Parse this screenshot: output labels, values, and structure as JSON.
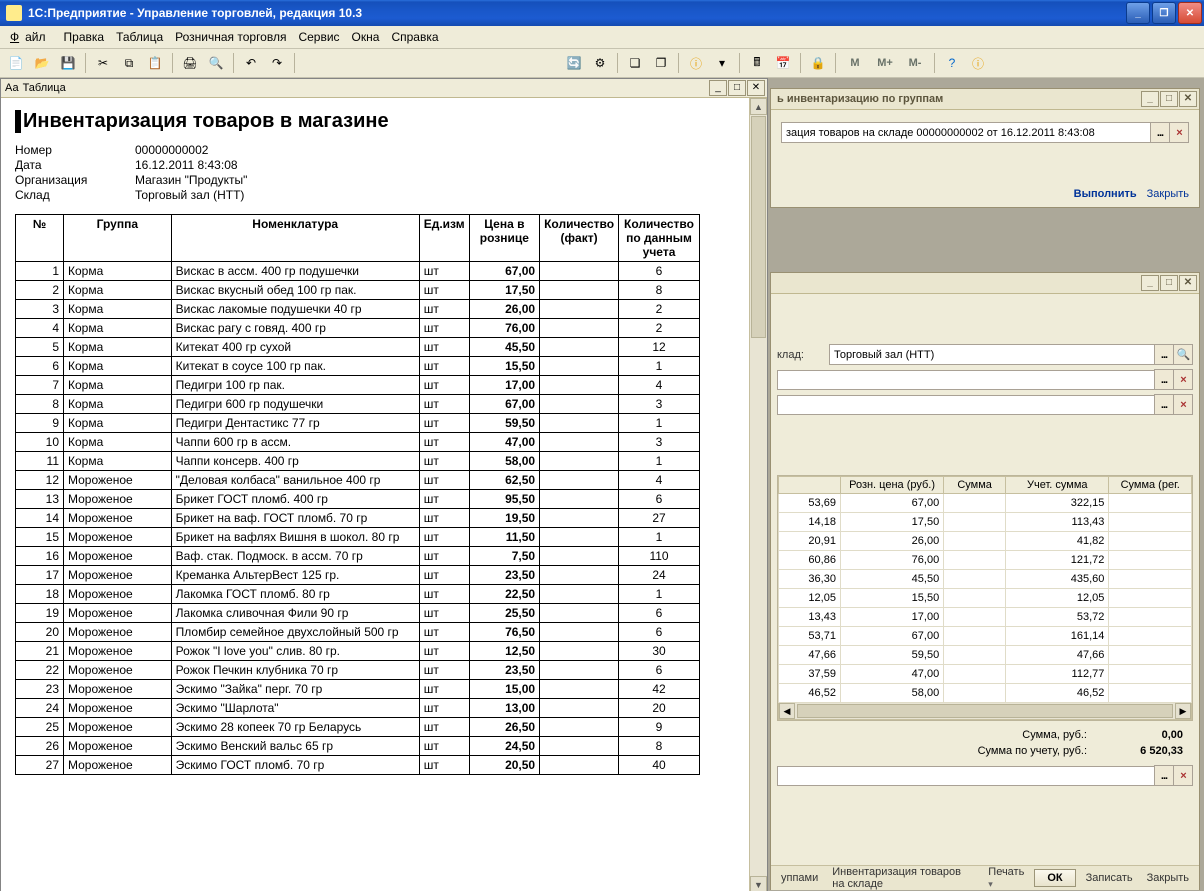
{
  "app": {
    "title": "1С:Предприятие - Управление торговлей, редакция 10.3"
  },
  "menu": {
    "items": [
      "Файл",
      "Правка",
      "Таблица",
      "Розничная торговля",
      "Сервис",
      "Окна",
      "Справка"
    ]
  },
  "toolbar": {
    "m_label": "М",
    "mplus_label": "М+",
    "mminus_label": "М-"
  },
  "doc": {
    "tab_label": "Таблица",
    "title": "Инвентаризация товаров в магазине",
    "info": {
      "number_label": "Номер",
      "number": "00000000002",
      "date_label": "Дата",
      "date": "16.12.2011 8:43:08",
      "org_label": "Организация",
      "org": "Магазин \"Продукты\"",
      "store_label": "Склад",
      "store": "Торговый зал (НТТ)"
    },
    "columns": [
      "№",
      "Группа",
      "Номенклатура",
      "Ед.изм",
      "Цена в рознице",
      "Количество (факт)",
      "Количество по данным учета"
    ],
    "rows": [
      {
        "n": 1,
        "g": "Корма",
        "nom": "Вискас в ассм. 400 гр подушечки",
        "u": "шт",
        "price": "67,00",
        "fact": "",
        "acc": "6"
      },
      {
        "n": 2,
        "g": "Корма",
        "nom": "Вискас вкусный обед 100 гр пак.",
        "u": "шт",
        "price": "17,50",
        "fact": "",
        "acc": "8"
      },
      {
        "n": 3,
        "g": "Корма",
        "nom": "Вискас лакомые подушечки 40 гр",
        "u": "шт",
        "price": "26,00",
        "fact": "",
        "acc": "2"
      },
      {
        "n": 4,
        "g": "Корма",
        "nom": "Вискас рагу с говяд. 400 гр",
        "u": "шт",
        "price": "76,00",
        "fact": "",
        "acc": "2"
      },
      {
        "n": 5,
        "g": "Корма",
        "nom": "Китекат 400 гр сухой",
        "u": "шт",
        "price": "45,50",
        "fact": "",
        "acc": "12"
      },
      {
        "n": 6,
        "g": "Корма",
        "nom": "Китекат в соусе 100 гр пак.",
        "u": "шт",
        "price": "15,50",
        "fact": "",
        "acc": "1"
      },
      {
        "n": 7,
        "g": "Корма",
        "nom": "Педигри 100 гр пак.",
        "u": "шт",
        "price": "17,00",
        "fact": "",
        "acc": "4"
      },
      {
        "n": 8,
        "g": "Корма",
        "nom": "Педигри 600 гр подушечки",
        "u": "шт",
        "price": "67,00",
        "fact": "",
        "acc": "3"
      },
      {
        "n": 9,
        "g": "Корма",
        "nom": "Педигри Дентастикс 77 гр",
        "u": "шт",
        "price": "59,50",
        "fact": "",
        "acc": "1"
      },
      {
        "n": 10,
        "g": "Корма",
        "nom": "Чаппи 600 гр в ассм.",
        "u": "шт",
        "price": "47,00",
        "fact": "",
        "acc": "3"
      },
      {
        "n": 11,
        "g": "Корма",
        "nom": "Чаппи консерв. 400 гр",
        "u": "шт",
        "price": "58,00",
        "fact": "",
        "acc": "1"
      },
      {
        "n": 12,
        "g": "Мороженое",
        "nom": "\"Деловая колбаса\" ванильное 400 гр",
        "u": "шт",
        "price": "62,50",
        "fact": "",
        "acc": "4"
      },
      {
        "n": 13,
        "g": "Мороженое",
        "nom": "Брикет ГОСТ пломб. 400 гр",
        "u": "шт",
        "price": "95,50",
        "fact": "",
        "acc": "6"
      },
      {
        "n": 14,
        "g": "Мороженое",
        "nom": "Брикет на ваф. ГОСТ пломб. 70 гр",
        "u": "шт",
        "price": "19,50",
        "fact": "",
        "acc": "27"
      },
      {
        "n": 15,
        "g": "Мороженое",
        "nom": "Брикет на вафлях Вишня в шокол. 80 гр",
        "u": "шт",
        "price": "11,50",
        "fact": "",
        "acc": "1"
      },
      {
        "n": 16,
        "g": "Мороженое",
        "nom": "Ваф. стак. Подмоск. в ассм. 70 гр",
        "u": "шт",
        "price": "7,50",
        "fact": "",
        "acc": "110"
      },
      {
        "n": 17,
        "g": "Мороженое",
        "nom": "Креманка АльтерВест 125 гр.",
        "u": "шт",
        "price": "23,50",
        "fact": "",
        "acc": "24"
      },
      {
        "n": 18,
        "g": "Мороженое",
        "nom": "Лакомка ГОСТ пломб. 80 гр",
        "u": "шт",
        "price": "22,50",
        "fact": "",
        "acc": "1"
      },
      {
        "n": 19,
        "g": "Мороженое",
        "nom": "Лакомка сливочная Фили 90 гр",
        "u": "шт",
        "price": "25,50",
        "fact": "",
        "acc": "6"
      },
      {
        "n": 20,
        "g": "Мороженое",
        "nom": "Пломбир семейное двухслойный 500 гр",
        "u": "шт",
        "price": "76,50",
        "fact": "",
        "acc": "6"
      },
      {
        "n": 21,
        "g": "Мороженое",
        "nom": "Рожок \"I love you\" слив. 80 гр.",
        "u": "шт",
        "price": "12,50",
        "fact": "",
        "acc": "30"
      },
      {
        "n": 22,
        "g": "Мороженое",
        "nom": "Рожок Печкин клубника 70 гр",
        "u": "шт",
        "price": "23,50",
        "fact": "",
        "acc": "6"
      },
      {
        "n": 23,
        "g": "Мороженое",
        "nom": "Эскимо \"Зайка\" перг. 70 гр",
        "u": "шт",
        "price": "15,00",
        "fact": "",
        "acc": "42"
      },
      {
        "n": 24,
        "g": "Мороженое",
        "nom": "Эскимо \"Шарлота\"",
        "u": "шт",
        "price": "13,00",
        "fact": "",
        "acc": "20"
      },
      {
        "n": 25,
        "g": "Мороженое",
        "nom": "Эскимо 28 копеек 70 гр Беларусь",
        "u": "шт",
        "price": "26,50",
        "fact": "",
        "acc": "9"
      },
      {
        "n": 26,
        "g": "Мороженое",
        "nom": "Эскимо Венский вальс 65 гр",
        "u": "шт",
        "price": "24,50",
        "fact": "",
        "acc": "8"
      },
      {
        "n": 27,
        "g": "Мороженое",
        "nom": "Эскимо ГОСТ пломб. 70 гр",
        "u": "шт",
        "price": "20,50",
        "fact": "",
        "acc": "40"
      }
    ]
  },
  "dlg1": {
    "title_suffix": "ь инвентаризацию по группам",
    "value_prefix": "зация товаров на складе 00000000002 от 16.12.2011 8:43:08",
    "execute": "Выполнить",
    "close": "Закрыть"
  },
  "dlg2": {
    "store_label": "клад:",
    "store_value": "Торговый зал (НТТ)",
    "grid_columns": [
      "",
      "Розн. цена (руб.)",
      "Сумма",
      "Учет. сумма",
      "Сумма (рег."
    ],
    "grid_rows": [
      {
        "c1": "53,69",
        "c2": "67,00",
        "c3": "",
        "c4": "322,15",
        "c5": ""
      },
      {
        "c1": "14,18",
        "c2": "17,50",
        "c3": "",
        "c4": "113,43",
        "c5": ""
      },
      {
        "c1": "20,91",
        "c2": "26,00",
        "c3": "",
        "c4": "41,82",
        "c5": ""
      },
      {
        "c1": "60,86",
        "c2": "76,00",
        "c3": "",
        "c4": "121,72",
        "c5": ""
      },
      {
        "c1": "36,30",
        "c2": "45,50",
        "c3": "",
        "c4": "435,60",
        "c5": ""
      },
      {
        "c1": "12,05",
        "c2": "15,50",
        "c3": "",
        "c4": "12,05",
        "c5": ""
      },
      {
        "c1": "13,43",
        "c2": "17,00",
        "c3": "",
        "c4": "53,72",
        "c5": ""
      },
      {
        "c1": "53,71",
        "c2": "67,00",
        "c3": "",
        "c4": "161,14",
        "c5": ""
      },
      {
        "c1": "47,66",
        "c2": "59,50",
        "c3": "",
        "c4": "47,66",
        "c5": ""
      },
      {
        "c1": "37,59",
        "c2": "47,00",
        "c3": "",
        "c4": "112,77",
        "c5": ""
      },
      {
        "c1": "46,52",
        "c2": "58,00",
        "c3": "",
        "c4": "46,52",
        "c5": ""
      }
    ],
    "sum_label": "Сумма, руб.:",
    "sum_value": "0,00",
    "sum_acc_label": "Сумма по учету, руб.:",
    "sum_acc_value": "6 520,33",
    "footer": {
      "groups": "уппами",
      "inv": "Инвентаризация товаров на складе",
      "print": "Печать",
      "ok": "ОК",
      "save": "Записать",
      "close": "Закрыть"
    }
  }
}
